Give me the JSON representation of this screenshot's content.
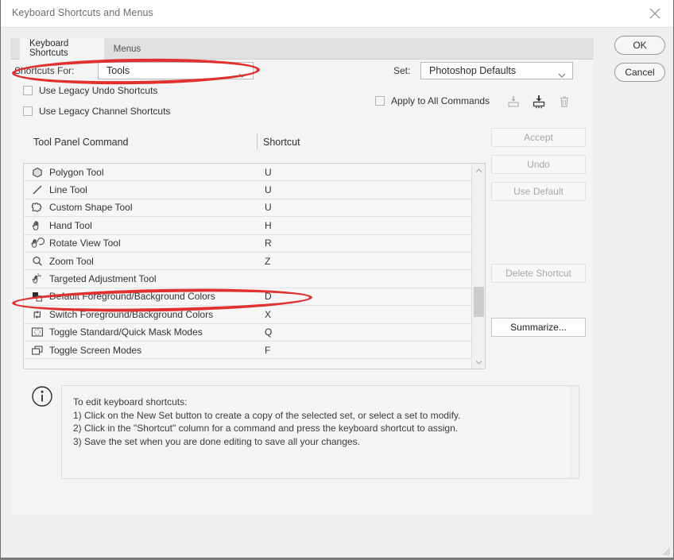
{
  "window": {
    "title": "Keyboard Shortcuts and Menus",
    "close_icon": "close-icon"
  },
  "tabs": [
    {
      "label": "Keyboard Shortcuts",
      "active": true
    },
    {
      "label": "Menus",
      "active": false
    }
  ],
  "form": {
    "shortcuts_for_label": "Shortcuts For:",
    "shortcuts_for_value": "Tools",
    "set_label": "Set:",
    "set_value": "Photoshop Defaults",
    "checkboxes": [
      {
        "label": "Use Legacy Undo Shortcuts",
        "checked": false
      },
      {
        "label": "Use Legacy Channel Shortcuts",
        "checked": false
      },
      {
        "label": "Apply to All Commands",
        "checked": false
      }
    ],
    "set_icons": [
      {
        "name": "new-set-icon",
        "enabled": false
      },
      {
        "name": "save-set-icon",
        "enabled": true
      },
      {
        "name": "delete-set-icon",
        "enabled": false
      }
    ]
  },
  "list": {
    "columns": [
      "Tool Panel Command",
      "Shortcut"
    ],
    "rows": [
      {
        "icon": "polygon-tool-icon",
        "command": "Polygon Tool",
        "shortcut": "U"
      },
      {
        "icon": "line-tool-icon",
        "command": "Line Tool",
        "shortcut": "U"
      },
      {
        "icon": "custom-shape-tool-icon",
        "command": "Custom Shape Tool",
        "shortcut": "U"
      },
      {
        "icon": "hand-tool-icon",
        "command": "Hand Tool",
        "shortcut": "H"
      },
      {
        "icon": "rotate-view-tool-icon",
        "command": "Rotate View Tool",
        "shortcut": "R"
      },
      {
        "icon": "zoom-tool-icon",
        "command": "Zoom Tool",
        "shortcut": "Z"
      },
      {
        "icon": "targeted-adjustment-tool-icon",
        "command": "Targeted Adjustment Tool",
        "shortcut": ""
      },
      {
        "icon": "default-colors-icon",
        "command": "Default Foreground/Background Colors",
        "shortcut": "D"
      },
      {
        "icon": "switch-colors-icon",
        "command": "Switch Foreground/Background Colors",
        "shortcut": "X"
      },
      {
        "icon": "quick-mask-icon",
        "command": "Toggle Standard/Quick Mask Modes",
        "shortcut": "Q"
      },
      {
        "icon": "screen-modes-icon",
        "command": "Toggle Screen Modes",
        "shortcut": "F"
      }
    ]
  },
  "side_buttons": [
    {
      "label": "Accept",
      "enabled": false
    },
    {
      "label": "Undo",
      "enabled": false
    },
    {
      "label": "Use Default",
      "enabled": false
    },
    {
      "label": "Delete Shortcut",
      "enabled": false
    },
    {
      "label": "Summarize...",
      "enabled": true
    }
  ],
  "info": {
    "icon": "info-icon",
    "text": "To edit keyboard shortcuts:\n1) Click on the New Set button to create a copy of the selected set, or select a set to modify.\n2) Click in the \"Shortcut\" column for a command and press the keyboard shortcut to assign.\n3) Save the set when you are done editing to save all your changes."
  },
  "dialog_buttons": [
    {
      "label": "OK"
    },
    {
      "label": "Cancel"
    }
  ],
  "annotations": {
    "color": "#e03030",
    "shapes": [
      {
        "target": "shortcuts-for-row"
      },
      {
        "target": "default-foreground-background-colors-row"
      }
    ]
  }
}
